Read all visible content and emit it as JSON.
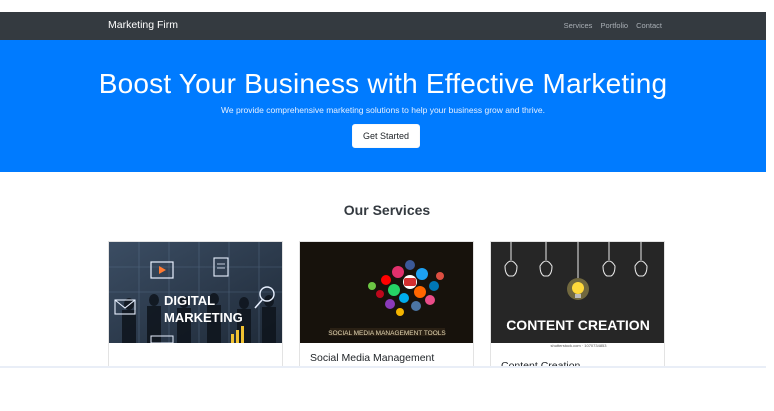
{
  "navbar": {
    "brand": "Marketing Firm",
    "links": [
      "Services",
      "Portfolio",
      "Contact"
    ]
  },
  "hero": {
    "title": "Boost Your Business with Effective Marketing",
    "subtitle": "We provide comprehensive marketing solutions to help your business grow and thrive.",
    "cta_label": "Get Started"
  },
  "services": {
    "heading": "Our Services",
    "cards": [
      {
        "title": "",
        "image_text": [
          "DIGITAL",
          "MARKETING"
        ],
        "image_icons": [
          "play-icon",
          "document-icon",
          "magnifier-icon",
          "mail-icon",
          "ad-icon",
          "bar-chart-icon"
        ]
      },
      {
        "title": "Social Media Management",
        "image_text": [
          "SOCIAL MEDIA MANAGEMENT TOOLS"
        ]
      },
      {
        "title": "Content Creation",
        "image_text": [
          "CONTENT CREATION",
          "shutterstock.com · 1070734853"
        ],
        "image_icons": [
          "light-bulb-icon"
        ]
      }
    ]
  },
  "colors": {
    "navbar": "#343a40",
    "hero": "#007bff",
    "white": "#ffffff"
  }
}
